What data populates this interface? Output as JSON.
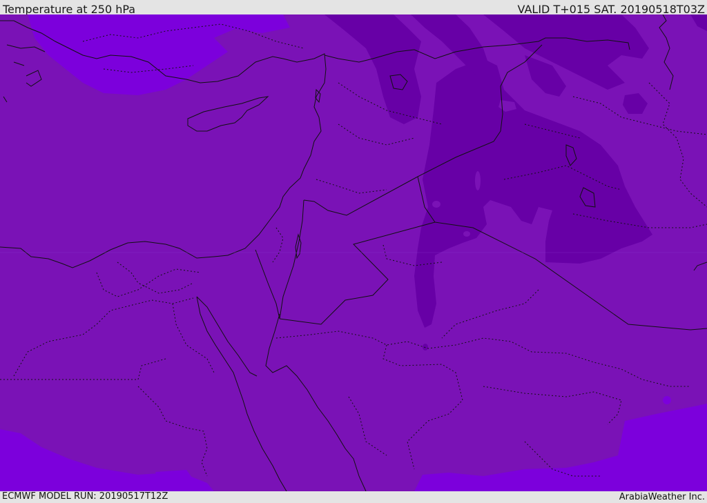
{
  "header": {
    "title": "Temperature at 250 hPa",
    "valid": "VALID T+015 SAT. 20190518T03Z"
  },
  "footer": {
    "model_run": "ECMWF MODEL RUN: 20190517T12Z",
    "credit": "ArabiaWeather Inc."
  },
  "map": {
    "colors": {
      "base": "#7a12b6",
      "warm": "#7c00dc",
      "cold": "#6700a6",
      "coast": "#111111"
    }
  }
}
